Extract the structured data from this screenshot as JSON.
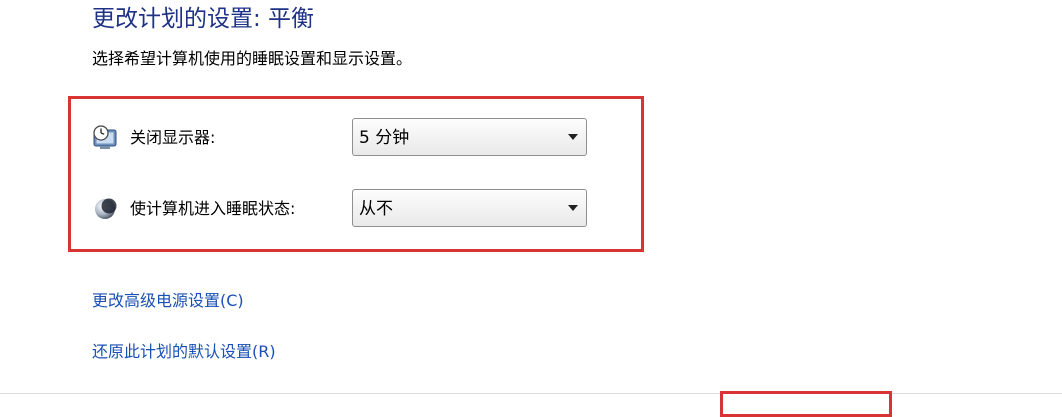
{
  "header": {
    "title": "更改计划的设置: 平衡",
    "subtitle": "选择希望计算机使用的睡眠设置和显示设置。"
  },
  "settings": [
    {
      "label": "关闭显示器:",
      "icon": "monitor-clock-icon",
      "selected_value": "5 分钟"
    },
    {
      "label": "使计算机进入睡眠状态:",
      "icon": "moon-sleep-icon",
      "selected_value": "从不"
    }
  ],
  "links": {
    "advanced": "更改高级电源设置(C)",
    "restore": "还原此计划的默认设置(R)"
  },
  "colors": {
    "title": "#1e3287",
    "link": "#1a4fb5",
    "highlight": "#d83434"
  }
}
